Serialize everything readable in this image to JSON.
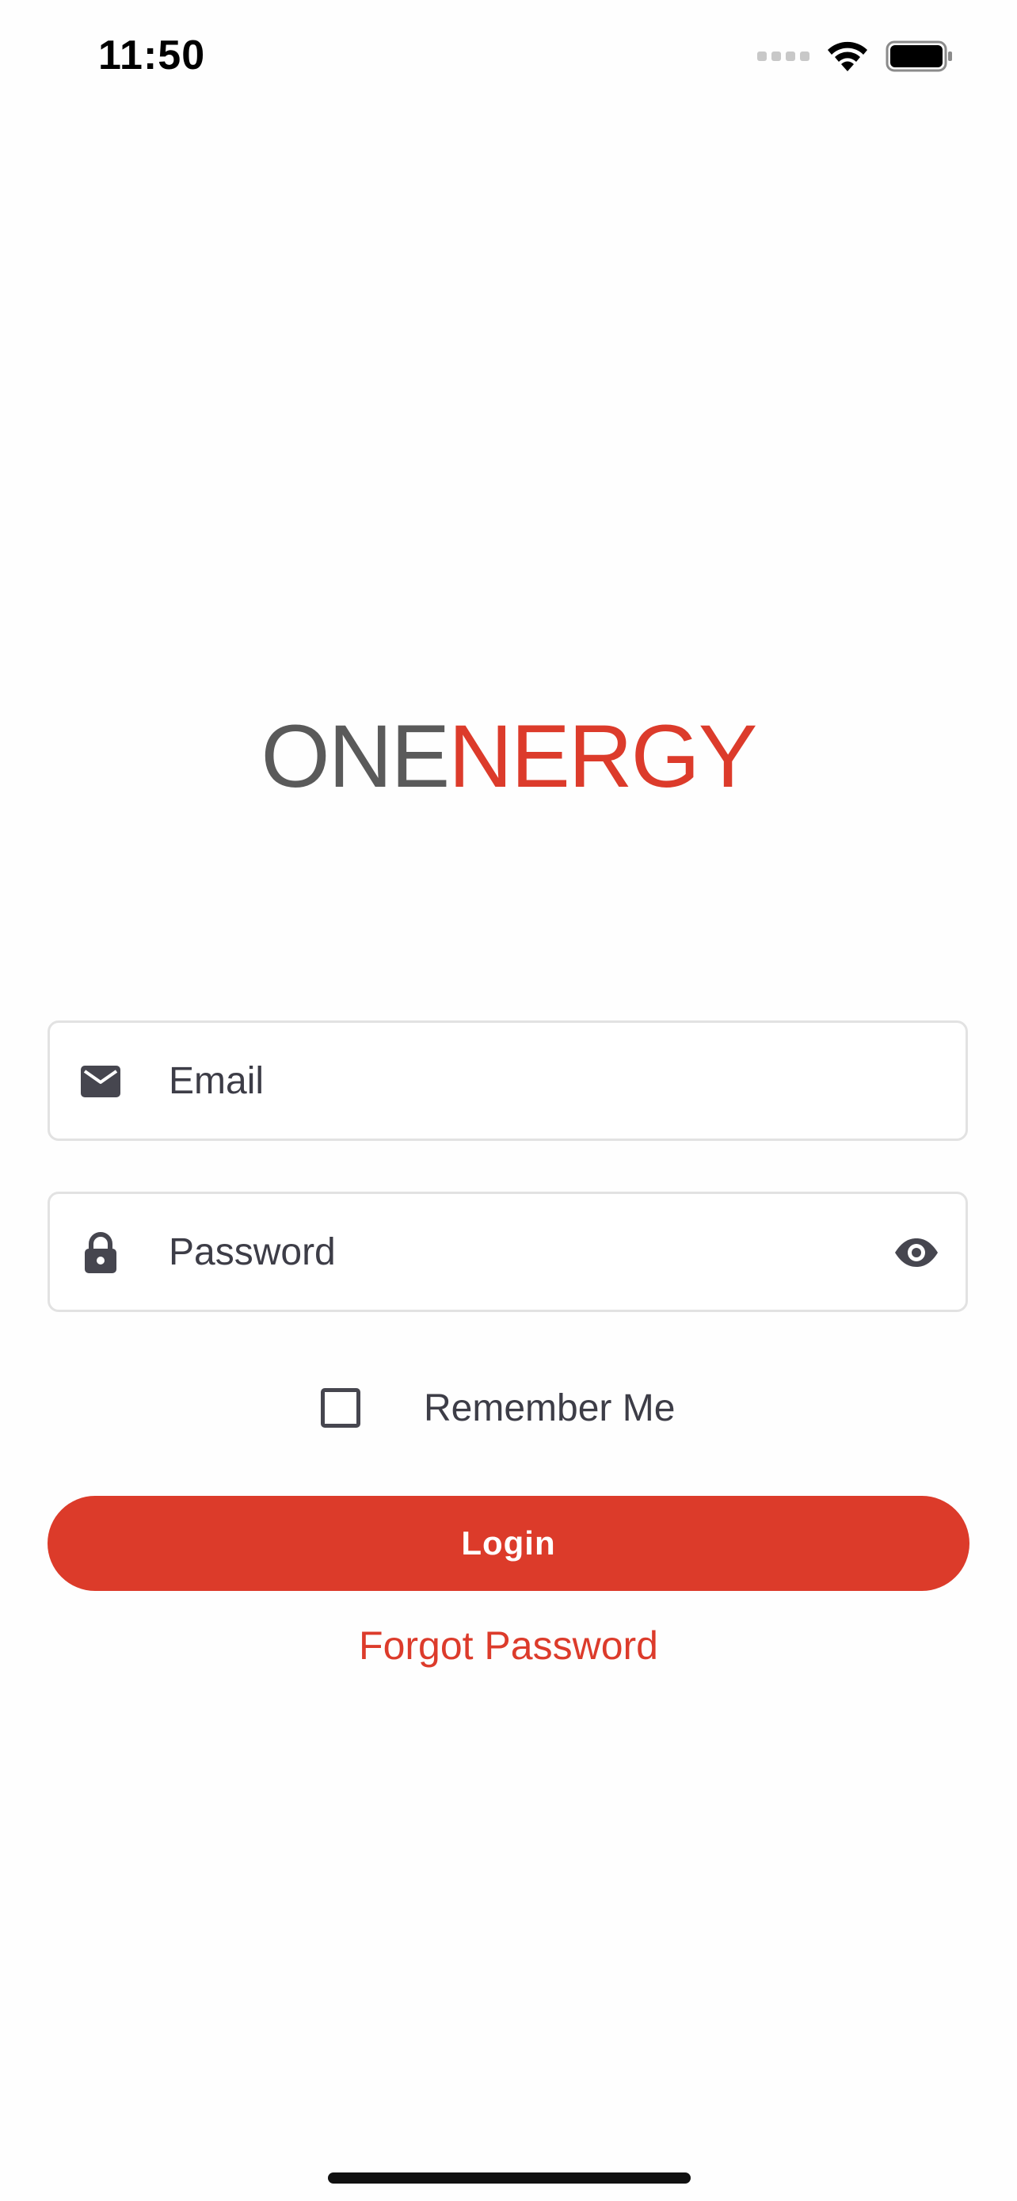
{
  "status_bar": {
    "time": "11:50",
    "icons": [
      "cellular-signal-icon",
      "wifi-icon",
      "battery-icon"
    ]
  },
  "logo": {
    "part_one": "ONE",
    "part_two": "NERGY",
    "colors": {
      "part_one": "#5a5a5a",
      "part_two": "#dc3b2b"
    }
  },
  "form": {
    "email": {
      "placeholder": "Email",
      "value": "",
      "icon": "envelope-icon"
    },
    "password": {
      "placeholder": "Password",
      "value": "",
      "icon": "lock-icon",
      "toggle_icon": "eye-icon"
    },
    "remember_me": {
      "label": "Remember Me",
      "checked": false
    },
    "login_label": "Login",
    "forgot_password_label": "Forgot Password"
  },
  "colors": {
    "accent": "#dc3b2a",
    "text": "#3d3d47",
    "border": "#e2e2e2"
  }
}
